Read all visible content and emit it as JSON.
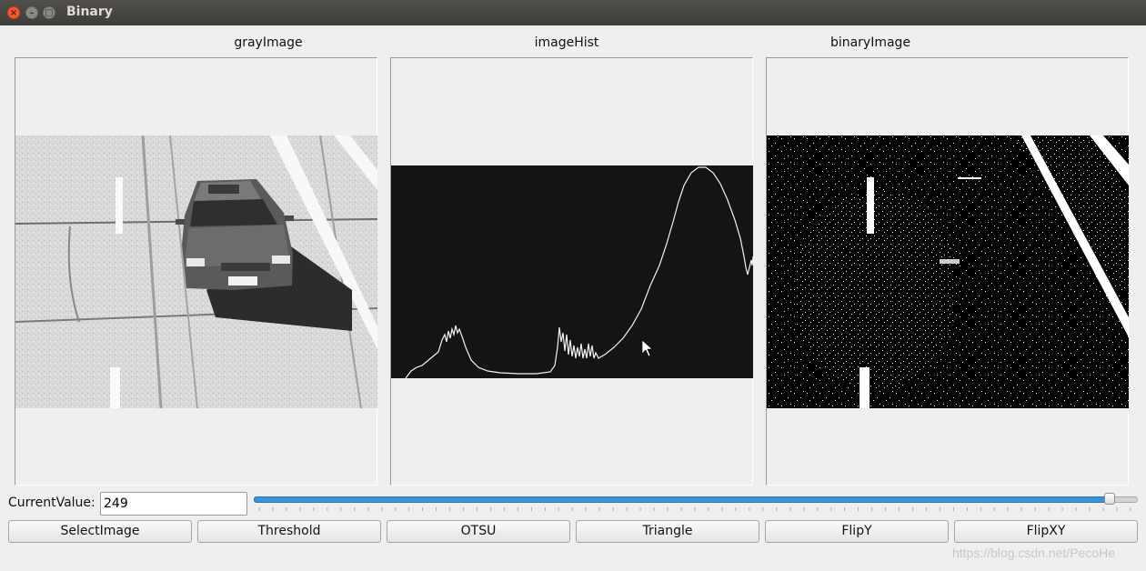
{
  "window": {
    "title": "Binary",
    "controls": [
      "close",
      "minimize",
      "maximize"
    ]
  },
  "panels": {
    "gray": {
      "label": "grayImage"
    },
    "hist": {
      "label": "imageHist"
    },
    "binary": {
      "label": "binaryImage"
    }
  },
  "controls": {
    "current_label": "CurrentValue:",
    "current_value": "249",
    "slider": {
      "value": 249,
      "min": 0,
      "max": 255
    }
  },
  "buttons": {
    "select": "SelectImage",
    "threshold": "Threshold",
    "otsu": "OTSU",
    "triangle": "Triangle",
    "flipy": "FlipY",
    "flipxy": "FlipXY"
  },
  "watermark": "https://blog.csdn.net/PecoHe",
  "colors": {
    "accent": "#3b93d6",
    "titlebar": "#3d3c38",
    "close": "#f05b31"
  }
}
